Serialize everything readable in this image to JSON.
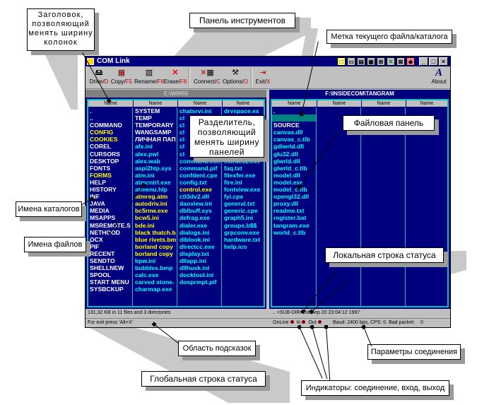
{
  "callouts": {
    "header": "Заголовок,\nпозволяющий\nменять ширину\nколонок",
    "toolbar": "Панель инструментов",
    "current_label": "Метка текущего файла/каталога",
    "splitter": "Разделитель,\nпозволяющий\nменять ширину\nпанелей",
    "file_panel": "Файловая панель",
    "dir_names": "Имена каталогов",
    "file_names": "Имена файлов",
    "local_status": "Локальная строка статуса",
    "hint_area": "Область подсказок",
    "link_params": "Параметры соединения",
    "global_status": "Глобальная строка статуса",
    "indicators": "Индикаторы: соединение, вход, выход"
  },
  "window": {
    "title": "COM Link"
  },
  "toolbar": {
    "drive": {
      "label": "Drive/",
      "hotkey": "D"
    },
    "copy": {
      "label": "Copy/",
      "hotkey": "F5"
    },
    "rename": {
      "label": "Rename/",
      "hotkey": "F6"
    },
    "erase": {
      "label": "Erase/",
      "hotkey": "F8"
    },
    "connect": {
      "label": "Connect/",
      "hotkey": "C"
    },
    "options": {
      "label": "Options/",
      "hotkey": "O"
    },
    "exit": {
      "label": "Exit/",
      "hotkey": "X"
    },
    "about": {
      "label": "About",
      "glyph": "A"
    }
  },
  "left_panel": {
    "path": "E:\\WIN95",
    "column_header": "Name",
    "columns": [
      [
        ".",
        "..",
        "COMMAND",
        "CONFIG",
        "COOKIES",
        "COREL",
        "CURSORS",
        "DESKTOP",
        "FONTS",
        "FORMS",
        "HELP",
        "HISTORY",
        "INF",
        "JAVA",
        "MEDIA",
        "MSAPPS",
        "MSREMOTE.S",
        "NETHOOD",
        "OCX",
        "PIF",
        "RECENT",
        "SENDTO",
        "SHELLNEW",
        "SPOOL",
        "START MENU",
        "SYSBCKUP"
      ],
      [
        "SYSTEM",
        "TEMP",
        "TEMPORARY",
        "WANGSAMP",
        "ЛИЧНАЯ ПАП",
        "afx.ini",
        "alex.pwl",
        "alex.wab",
        "aspi2hlp.sys",
        "atm.ini",
        "atmcntrl.exe",
        "atmenu.hlp",
        "atmreg.atm",
        "autodriv.ini",
        "bc5rnw.exe",
        "bcw5.ini",
        "bde.ini",
        "black thatch.b",
        "blue rivets.bm",
        "borland copy",
        "borland copy",
        "bpw.ini",
        "bubbles.bmp",
        "calc.exe",
        "carved stone.",
        "charmap.exe"
      ],
      [
        "chatsrvi.ini",
        "cl",
        "cl",
        "cl",
        "cl",
        "cl",
        "cl",
        "command.com",
        "command.pif",
        "confdent.cpe",
        "config.txt",
        "control.exe",
        "ctl3dv2.dll",
        "daoview.ini",
        "dblbuff.sys",
        "defrag.exe",
        "dialer.exe",
        "dialogs.ini",
        "diblook.ini",
        "directcc.exe",
        "display.txt",
        "dllapp.ini",
        "dllhusk.ini",
        "docktool.ini",
        "dosprmpt.pif"
      ],
      [
        "drvspace.ex",
        "",
        "",
        "",
        "",
        "",
        "",
        "exchange.ts",
        "exchng32.ini",
        "exit to dos.j",
        "explorer.exe",
        "expostrt.exe",
        "extra.txt",
        "extrac32.exe",
        "faq.txt",
        "filexfer.exe",
        "fire.ini",
        "fontview.exe",
        "fyi.cpe",
        "general.txt",
        "generic.cpe",
        "graph5.ini",
        "groups.b$$",
        "grpconv.exe",
        "hardware.txt",
        "help.ico"
      ]
    ]
  },
  "right_panel": {
    "path": "F:\\INSIDECOM\\TANGRAM",
    "column_header": "Name",
    "files": [
      ".",
      "..",
      "SOURCE",
      "canvas.dll",
      "canvas_c.tlb",
      "gdiwrld.dll",
      "glu32.dll",
      "glwrld.dll",
      "glwrld_c.tlb",
      "model.dll",
      "model.exe",
      "model_c.tlb",
      "opengl32.dll",
      "proxy.dll",
      "readme.txt",
      "register.bat",
      "tangram.exe",
      "world_c.tlb"
    ]
  },
  "status": {
    "left_local": "131,32 KB  in 11 files and 3 directories",
    "right_local": "...    <SUB-DIR>  5d Sep 20 23:04:12 1997",
    "hint": "For exit press 'Alt+X'",
    "online": "OnLine",
    "in": "In",
    "out": "Out",
    "baud": "Baud:",
    "baud_value": "2400 bps,",
    "cps": "CPS:",
    "cps_value": "0.",
    "bad_packet": "Bad packet:",
    "bad_packet_value": "0"
  }
}
